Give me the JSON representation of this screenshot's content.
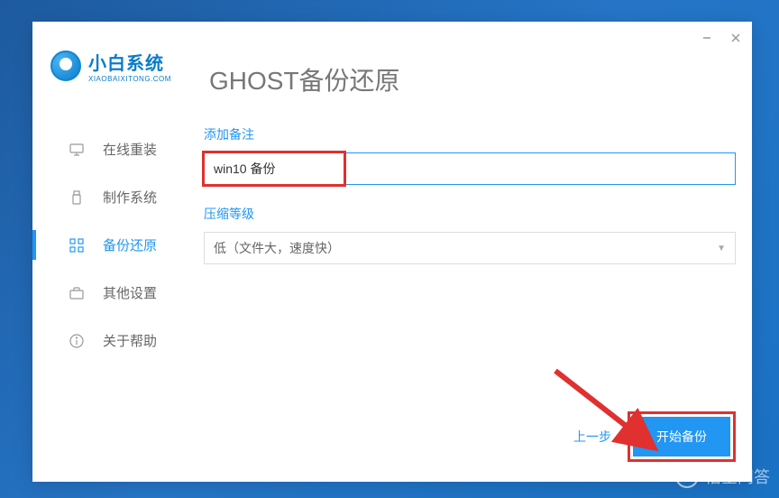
{
  "logo": {
    "title": "小白系统",
    "sub": "XIAOBAIXITONG.COM"
  },
  "page_title": "GHOST备份还原",
  "sidebar": {
    "items": [
      {
        "label": "在线重装"
      },
      {
        "label": "制作系统"
      },
      {
        "label": "备份还原"
      },
      {
        "label": "其他设置"
      },
      {
        "label": "关于帮助"
      }
    ]
  },
  "form": {
    "remark_label": "添加备注",
    "remark_value": "win10 备份",
    "compress_label": "压缩等级",
    "compress_value": "低（文件大，速度快）"
  },
  "buttons": {
    "prev": "上一步",
    "start": "开始备份"
  },
  "watermark": "悟空问答"
}
